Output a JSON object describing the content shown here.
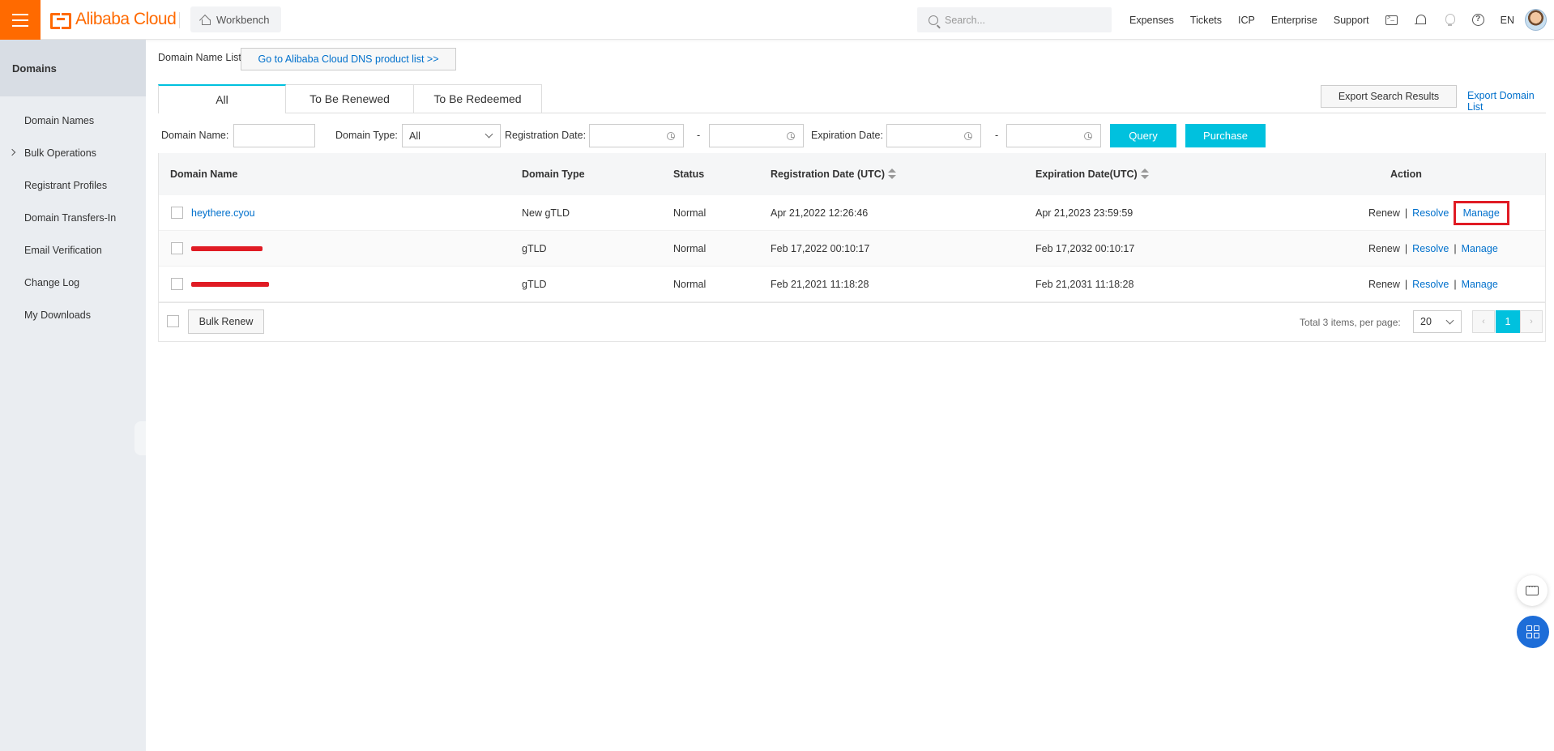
{
  "topbar": {
    "brand": "Alibaba Cloud",
    "workbench": "Workbench",
    "search_placeholder": "Search...",
    "links": [
      "Expenses",
      "Tickets",
      "ICP",
      "Enterprise",
      "Support"
    ],
    "lang": "EN"
  },
  "sidebar": {
    "title": "Domains",
    "items": [
      {
        "label": "Domain Names"
      },
      {
        "label": "Bulk Operations"
      },
      {
        "label": "Registrant Profiles"
      },
      {
        "label": "Domain Transfers-In"
      },
      {
        "label": "Email Verification"
      },
      {
        "label": "Change Log"
      },
      {
        "label": "My Downloads"
      }
    ]
  },
  "main": {
    "list_label": "Domain Name List",
    "dns_link": "Go to Alibaba Cloud DNS product list >>",
    "tabs": [
      "All",
      "To Be Renewed",
      "To Be Redeemed"
    ],
    "export_results": "Export Search Results",
    "export_list": "Export Domain List",
    "filters": {
      "domain_name": "Domain Name:",
      "domain_type": "Domain Type:",
      "domain_type_value": "All",
      "reg_date": "Registration Date:",
      "exp_date": "Expiration Date:",
      "dash": "-",
      "query": "Query",
      "purchase": "Purchase"
    },
    "table": {
      "headers": {
        "name": "Domain Name",
        "type": "Domain Type",
        "status": "Status",
        "reg": "Registration Date (UTC)",
        "exp": "Expiration Date(UTC)",
        "action": "Action"
      },
      "rows": [
        {
          "name": "heythere.cyou",
          "type": "New gTLD",
          "status": "Normal",
          "reg": "Apr 21,2022 12:26:46",
          "exp": "Apr 21,2023 23:59:59"
        },
        {
          "name": "",
          "type": "gTLD",
          "status": "Normal",
          "reg": "Feb 17,2022 00:10:17",
          "exp": "Feb 17,2032 00:10:17"
        },
        {
          "name": "",
          "type": "gTLD",
          "status": "Normal",
          "reg": "Feb 21,2021 11:18:28",
          "exp": "Feb 21,2031 11:18:28"
        }
      ],
      "actions": {
        "renew": "Renew",
        "resolve": "Resolve",
        "manage": "Manage",
        "sep": "|"
      }
    },
    "footer": {
      "bulk_renew": "Bulk Renew",
      "total": "Total 3 items,  per page:",
      "page_size": "20",
      "current_page": "1",
      "prev": "‹",
      "next": "›"
    }
  },
  "colors": {
    "brand": "#ff6a00",
    "accent": "#00c1de",
    "link": "#0070cc",
    "highlight": "#e01b24"
  }
}
